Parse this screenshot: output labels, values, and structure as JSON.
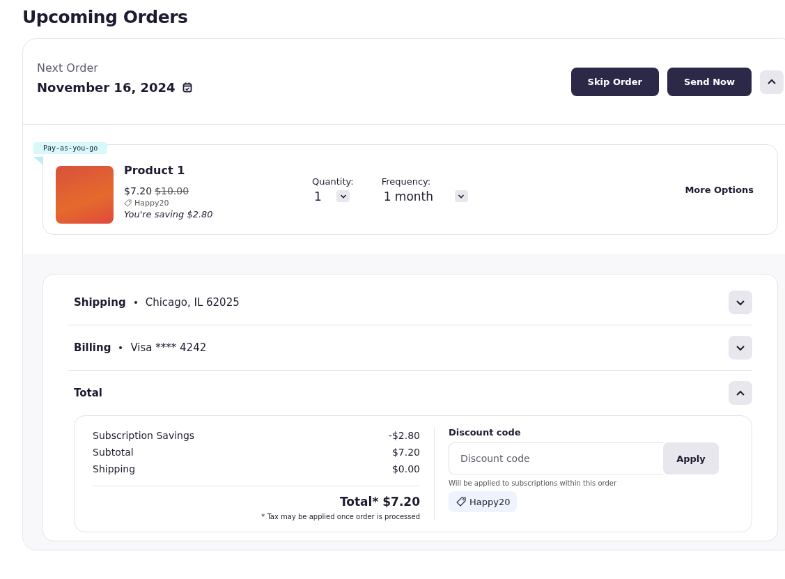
{
  "page_title": "Upcoming Orders",
  "order": {
    "label": "Next Order",
    "date": "November 16, 2024",
    "buttons": [
      {
        "label": "Skip Order"
      },
      {
        "label": "Send Now"
      }
    ],
    "expanded": true
  },
  "product": {
    "badge": "Pay-as-you-go",
    "name": "Product 1",
    "price": "$7.20",
    "original_price": "$10.00",
    "coupon": "Happy20",
    "savings": "You're saving $2.80",
    "selects": [
      {
        "label": "Quantity:",
        "value": "1"
      },
      {
        "label": "Frequency:",
        "value": "1 month"
      }
    ],
    "more_options": "More Options"
  },
  "sections": [
    {
      "title": "Shipping",
      "value": "Chicago, IL 62025",
      "expanded": false
    },
    {
      "title": "Billing",
      "value": "Visa **** 4242",
      "expanded": false
    },
    {
      "title": "Total",
      "expanded": true
    }
  ],
  "summary": {
    "rows": [
      {
        "label": "Subscription Savings",
        "value": "-$2.80"
      },
      {
        "label": "Subtotal",
        "value": "$7.20"
      },
      {
        "label": "Shipping",
        "value": "$0.00"
      }
    ],
    "total": "Total* $7.20",
    "note": "* Tax may be applied once order is processed"
  },
  "discount": {
    "label": "Discount code",
    "placeholder": "Discount code",
    "button": "Apply",
    "hint": "Will be applied to subscriptions within this order",
    "applied": "Happy20"
  }
}
